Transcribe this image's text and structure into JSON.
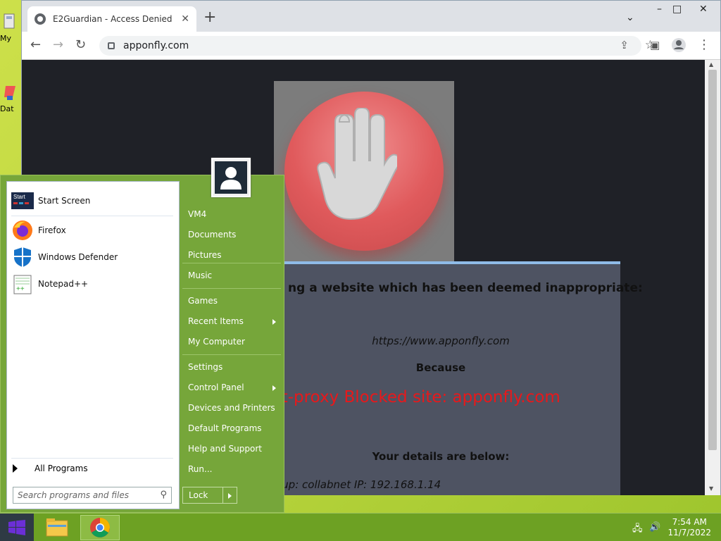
{
  "desktop": {
    "icons": [
      {
        "label": "My"
      },
      {
        "label": "Dat"
      }
    ]
  },
  "browser": {
    "tab_title": "E2Guardian - Access Denied",
    "new_tab": "+",
    "url": "apponfly.com",
    "window_controls": {
      "chevron": "⌄",
      "minimize": "–",
      "maximize": "□",
      "close": "✕"
    }
  },
  "page": {
    "message_line": "ng a website which has been deemed inappropriate:",
    "blocked_url": "https://www.apponfly.com",
    "because_label": "Because",
    "reason": "net-proxy  Blocked site: apponfly.com",
    "details_label": "Your details are below:",
    "details": "oup: collabnet   IP: 192.168.1.14"
  },
  "start_menu": {
    "left_items": [
      {
        "label": "Start Screen",
        "icon": "start-screen-icon"
      },
      {
        "label": "Firefox",
        "icon": "firefox-icon"
      },
      {
        "label": "Windows Defender",
        "icon": "windows-defender-icon"
      },
      {
        "label": "Notepad++",
        "icon": "notepad-plus-plus-icon"
      }
    ],
    "all_programs": "All Programs",
    "search_placeholder": "Search programs and files",
    "right_items": [
      {
        "label": "VM4"
      },
      {
        "label": "Documents"
      },
      {
        "label": "Pictures"
      },
      {
        "label": "Music"
      },
      {
        "label": "Games"
      },
      {
        "label": "Recent Items"
      },
      {
        "label": "My Computer"
      },
      {
        "label": "Settings"
      },
      {
        "label": "Control Panel"
      },
      {
        "label": "Devices and Printers"
      },
      {
        "label": "Default Programs"
      },
      {
        "label": "Help and Support"
      },
      {
        "label": "Run..."
      }
    ],
    "lock_label": "Lock"
  },
  "taskbar": {
    "time": "7:54 AM",
    "date": "11/7/2022"
  },
  "colors": {
    "reason_text": "#e8181b",
    "menu_green": "#76a63a",
    "taskbar_green": "#6da123"
  }
}
